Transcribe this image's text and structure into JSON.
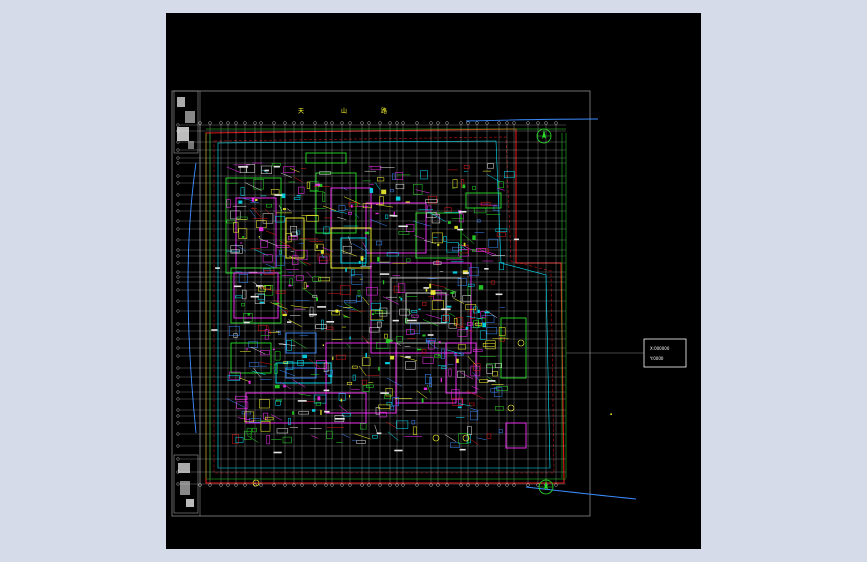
{
  "window": {
    "background": "#d6dbe9",
    "canvas_background": "#000000"
  },
  "drawing": {
    "title_chars": [
      "天",
      "山",
      "路"
    ],
    "legend_lines": [
      "X:000000",
      "Y:0000"
    ],
    "north_arrow_icon": "north-arrow-icon",
    "colors": {
      "boundary_red": "#e01818",
      "grid_white": "#e6e6e6",
      "axis_green": "#28e028",
      "cyan": "#00e8ff",
      "blue_road": "#3a8cff",
      "magenta": "#ff30ff",
      "yellow": "#ffff30",
      "gray_frame": "#8a8a8a"
    }
  }
}
